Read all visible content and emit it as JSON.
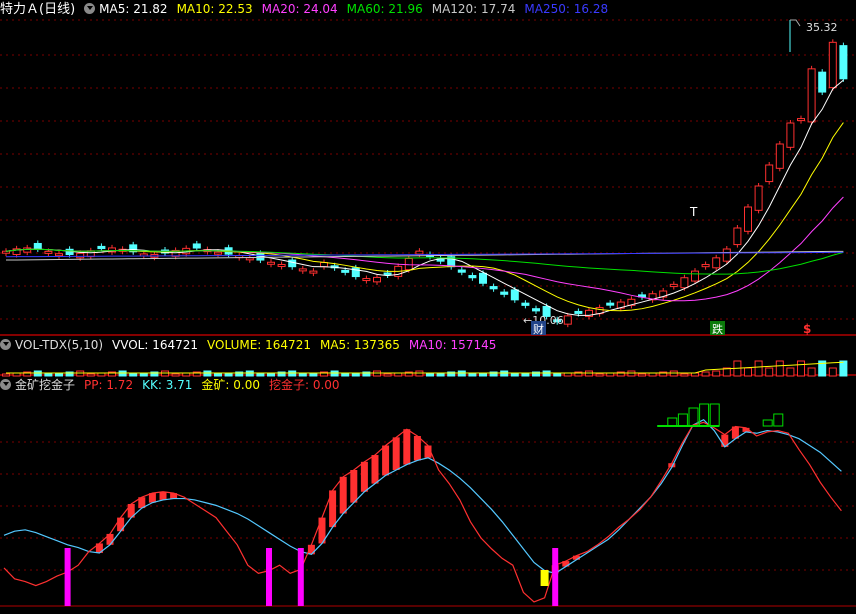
{
  "colors": {
    "up": "#ff3030",
    "down": "#54ffff",
    "ma5": "#ffffff",
    "ma10": "#ffff00",
    "ma20": "#ff40ff",
    "ma60": "#00e000",
    "ma120": "#c8c8c8",
    "ma250": "#3a3aff",
    "grid": "#7a0000"
  },
  "main": {
    "title": "特力Ａ(日线)",
    "ma5": "MA5: 21.82",
    "ma10": "MA10: 22.53",
    "ma20": "MA20: 24.04",
    "ma60": "MA60: 21.96",
    "ma120": "MA120: 17.74",
    "ma250": "MA250: 16.28",
    "high_label": "35.32",
    "low_label": "←10.06",
    "t_mark": "T",
    "cai_mark": "财",
    "die_mark": "跌",
    "dollar_mark": "$"
  },
  "vol": {
    "title": "VOL-TDX(5,10)",
    "vvol": "VVOL: 164721",
    "volume": "VOLUME: 164721",
    "ma5": "MA5: 137365",
    "ma10": "MA10: 157145"
  },
  "ind": {
    "title": "金矿挖金子",
    "pp_label": "PP:",
    "pp": "1.72",
    "kk_label": "KK:",
    "kk": "3.71",
    "jk": "金矿: 0.00",
    "wjz": "挖金子: 0.00"
  },
  "chart_data": {
    "type": "candlestick",
    "price_range": [
      9.0,
      37.5
    ],
    "high": 35.32,
    "low": 10.06,
    "kk": [
      5.2,
      5.5,
      5.6,
      5.4,
      5.1,
      4.8,
      4.5,
      4.3,
      4.0,
      3.9,
      4.5,
      5.5,
      6.5,
      7.2,
      7.6,
      7.8,
      7.9,
      7.9,
      7.8,
      7.6,
      7.4,
      7.1,
      6.8,
      6.4,
      5.9,
      5.4,
      4.9,
      4.4,
      4.0,
      3.8,
      4.6,
      5.8,
      6.8,
      7.6,
      8.4,
      9.0,
      9.6,
      10.0,
      10.4,
      10.7,
      10.9,
      10.5,
      10.0,
      9.4,
      8.7,
      7.9,
      7.1,
      6.2,
      5.2,
      4.2,
      3.2,
      2.6,
      2.4,
      2.9,
      3.4,
      3.9,
      4.4,
      4.9,
      5.6,
      6.4,
      7.2,
      8.0,
      9.0,
      10.2,
      11.8,
      13.3,
      13.7,
      12.9,
      11.7,
      12.3,
      12.8,
      12.7,
      12.9,
      12.8,
      12.6,
      12.3,
      11.8,
      11.3,
      10.6,
      9.9
    ],
    "pp": [
      2.8,
      2.0,
      1.8,
      1.5,
      1.8,
      2.2,
      2.5,
      3.0,
      4.0,
      4.6,
      5.3,
      6.5,
      7.5,
      8.0,
      8.3,
      8.4,
      8.3,
      8.0,
      7.5,
      7.0,
      6.5,
      5.5,
      4.5,
      3.0,
      2.4,
      2.6,
      3.0,
      2.4,
      2.7,
      4.5,
      6.5,
      8.5,
      9.5,
      10.0,
      10.6,
      11.1,
      11.8,
      12.4,
      13.0,
      12.5,
      11.8,
      10.0,
      9.0,
      7.8,
      6.2,
      5.0,
      4.2,
      3.5,
      3.0,
      1.0,
      0.3,
      0.6,
      3.0,
      3.3,
      3.7,
      4.0,
      4.5,
      5.1,
      5.8,
      6.4,
      7.1,
      8.0,
      9.2,
      10.5,
      12.0,
      13.3,
      13.5,
      13.1,
      12.6,
      13.2,
      13.1,
      12.5,
      12.8,
      12.9,
      12.7,
      11.5,
      10.4,
      9.1,
      8.0,
      7.0
    ],
    "jk_markers": [
      13,
      52
    ],
    "wjz_markers": [
      52
    ]
  }
}
